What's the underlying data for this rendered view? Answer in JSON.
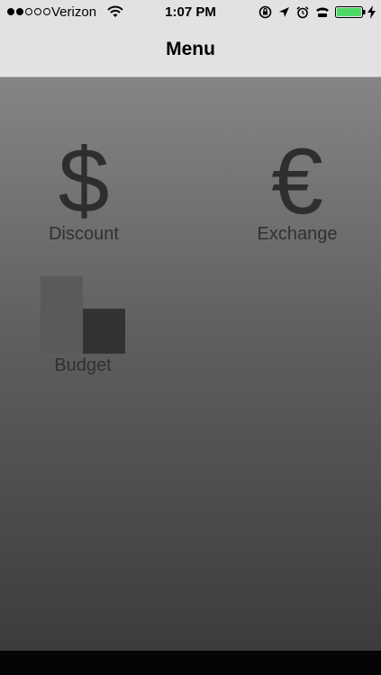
{
  "status_bar": {
    "carrier": "Verizon",
    "time": "1:07 PM",
    "battery_level": 1.0,
    "battery_color": "#4cd964"
  },
  "nav": {
    "title": "Menu"
  },
  "menu": {
    "discount": {
      "label": "Discount",
      "icon_glyph": "$",
      "icon": "dollar-icon"
    },
    "exchange": {
      "label": "Exchange",
      "icon_glyph": "€",
      "icon": "euro-icon"
    },
    "budget": {
      "label": "Budget",
      "icon": "bar-chart-icon"
    }
  }
}
